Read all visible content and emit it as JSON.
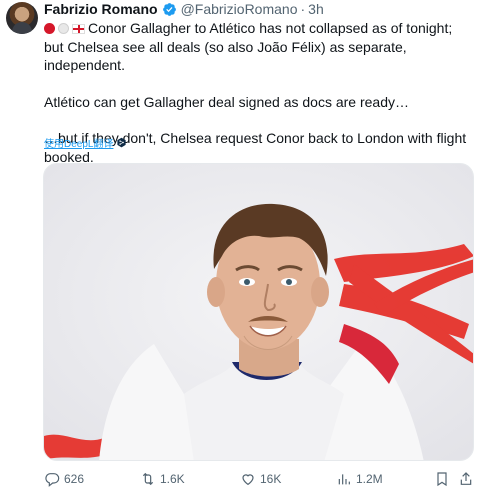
{
  "author": {
    "name": "Fabrizio Romano",
    "handle": "@FabrizioRomano",
    "separator": "·",
    "time": "3h"
  },
  "tweet": {
    "line1": "Conor Gallagher to Atlético has not collapsed as of tonight; but Chelsea see all deals (so also João Félix) as separate, independent.",
    "line2": "Atlético can get Gallagher deal signed as docs are ready…",
    "line3": "…but if they don't, Chelsea request Conor back to London with flight booked.",
    "emoji": [
      "red-circle",
      "white-circle",
      "england-flag"
    ]
  },
  "translate": {
    "label": "使用DeepL翻译"
  },
  "actions": {
    "replies": "626",
    "reposts": "1.6K",
    "likes": "16K",
    "views": "1.2M"
  },
  "colors": {
    "text": "#0f1419",
    "muted": "#536471",
    "accent": "#1d9bf0",
    "brush": "#e5322b"
  },
  "icons": [
    "verified-icon",
    "deepl-icon",
    "reply-icon",
    "repost-icon",
    "like-icon",
    "views-icon",
    "bookmark-icon",
    "share-icon"
  ]
}
